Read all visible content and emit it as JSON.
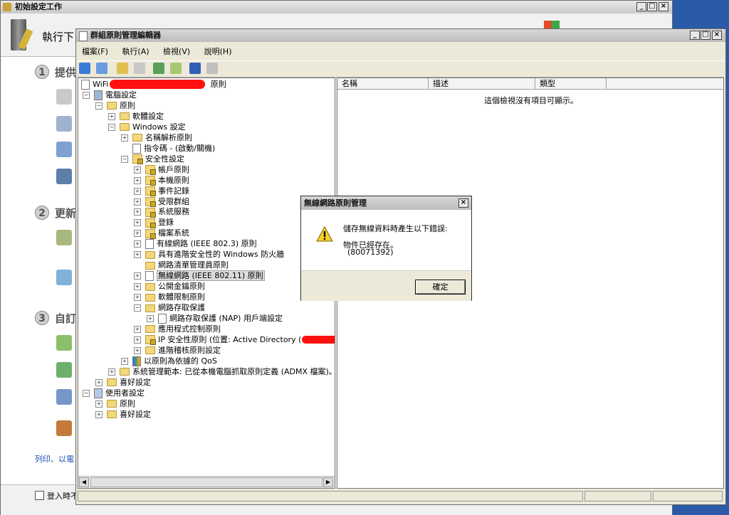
{
  "bg_window": {
    "title": "初始設定工作",
    "header_text": "執行下",
    "sections": [
      {
        "num": "1",
        "label": "提供"
      },
      {
        "num": "2",
        "label": "更新"
      },
      {
        "num": "3",
        "label": "自訂"
      }
    ],
    "footer_link": "列印、以電",
    "checkbox_label": "登入時不"
  },
  "mmc": {
    "title": "群組原則管理編輯器",
    "menu": [
      "檔案(F)",
      "執行(A)",
      "檢視(V)",
      "說明(H)"
    ],
    "tree": {
      "root_prefix": "WiFi",
      "root_suffix": "原則",
      "nodes": [
        {
          "label": "電腦設定",
          "indent": 0,
          "exp": "−",
          "icon": "computer"
        },
        {
          "label": "原則",
          "indent": 1,
          "exp": "−",
          "icon": "folder"
        },
        {
          "label": "軟體設定",
          "indent": 2,
          "exp": "+",
          "icon": "folder"
        },
        {
          "label": "Windows 設定",
          "indent": 2,
          "exp": "−",
          "icon": "folder"
        },
        {
          "label": "名稱解析原則",
          "indent": 3,
          "exp": "+",
          "icon": "folder"
        },
        {
          "label": "指令碼 - (啟動/關機)",
          "indent": 3,
          "exp": "",
          "icon": "doc"
        },
        {
          "label": "安全性設定",
          "indent": 3,
          "exp": "−",
          "icon": "lock"
        },
        {
          "label": "帳戶原則",
          "indent": 4,
          "exp": "+",
          "icon": "lock"
        },
        {
          "label": "本機原則",
          "indent": 4,
          "exp": "+",
          "icon": "lock"
        },
        {
          "label": "事件記錄",
          "indent": 4,
          "exp": "+",
          "icon": "lock"
        },
        {
          "label": "受限群組",
          "indent": 4,
          "exp": "+",
          "icon": "lock"
        },
        {
          "label": "系統服務",
          "indent": 4,
          "exp": "+",
          "icon": "lock"
        },
        {
          "label": "登錄",
          "indent": 4,
          "exp": "+",
          "icon": "lock"
        },
        {
          "label": "檔案系統",
          "indent": 4,
          "exp": "+",
          "icon": "lock"
        },
        {
          "label": "有線網路 (IEEE 802.3) 原則",
          "indent": 4,
          "exp": "+",
          "icon": "doc"
        },
        {
          "label": "具有進階安全性的 Windows 防火牆",
          "indent": 4,
          "exp": "+",
          "icon": "folder"
        },
        {
          "label": "網路清單管理員原則",
          "indent": 4,
          "exp": "",
          "icon": "folder"
        },
        {
          "label": "無線網路 (IEEE 802.11) 原則",
          "indent": 4,
          "exp": "+",
          "icon": "doc",
          "selected": true
        },
        {
          "label": "公開金鑰原則",
          "indent": 4,
          "exp": "+",
          "icon": "folder"
        },
        {
          "label": "軟體限制原則",
          "indent": 4,
          "exp": "+",
          "icon": "folder"
        },
        {
          "label": "網路存取保護",
          "indent": 4,
          "exp": "−",
          "icon": "folder"
        },
        {
          "label": "網路存取保護 (NAP) 用戶端設定",
          "indent": 5,
          "exp": "+",
          "icon": "doc"
        },
        {
          "label": "應用程式控制原則",
          "indent": 4,
          "exp": "+",
          "icon": "folder"
        },
        {
          "label": "IP 安全性原則 (位置: Active Directory (",
          "indent": 4,
          "exp": "+",
          "icon": "lock",
          "redacted_tail": true
        },
        {
          "label": "進階稽核原則設定",
          "indent": 4,
          "exp": "+",
          "icon": "folder"
        },
        {
          "label": "以原則為依據的 QoS",
          "indent": 3,
          "exp": "+",
          "icon": "chart"
        },
        {
          "label": "系統管理範本: 已從本機電腦抓取原則定義 (ADMX 檔案)。",
          "indent": 2,
          "exp": "+",
          "icon": "folder"
        },
        {
          "label": "喜好設定",
          "indent": 1,
          "exp": "+",
          "icon": "folder"
        },
        {
          "label": "使用者設定",
          "indent": 0,
          "exp": "−",
          "icon": "user"
        },
        {
          "label": "原則",
          "indent": 1,
          "exp": "+",
          "icon": "folder"
        },
        {
          "label": "喜好設定",
          "indent": 1,
          "exp": "+",
          "icon": "folder"
        }
      ]
    },
    "list": {
      "columns": [
        "名稱",
        "描述",
        "類型"
      ],
      "empty_text": "這個檢視沒有項目可顯示。"
    }
  },
  "dialog": {
    "title": "無線網路原則管理",
    "message": "儲存無線資料時產生以下錯誤:",
    "detail": "物件已經存在。",
    "code": "(80071392)",
    "ok_label": "確定"
  },
  "colors": {
    "desktop": "#2a5aa8",
    "window_bg": "#ece9d8",
    "selection": "#dcdcdc",
    "redaction": "#ff1010"
  }
}
